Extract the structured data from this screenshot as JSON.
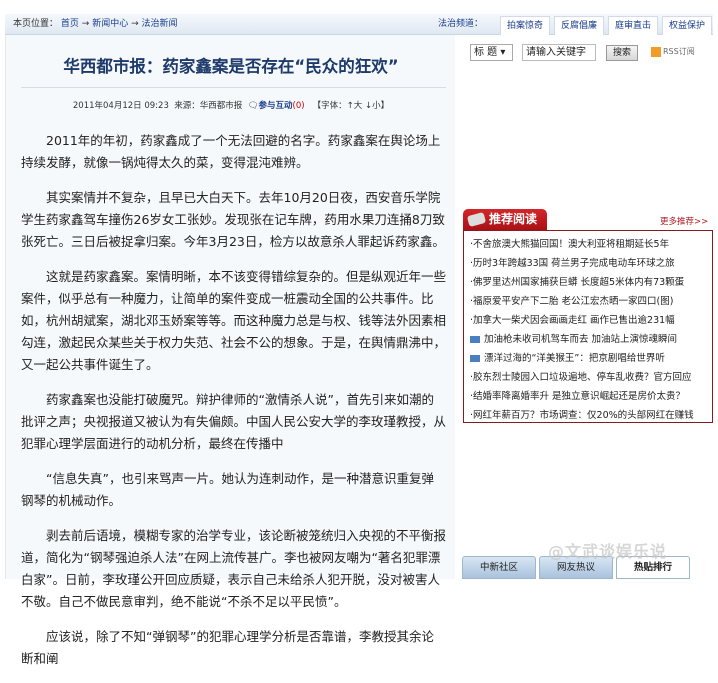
{
  "topbar": {
    "breadcrumb_label": "本页位置：",
    "crumbs": [
      "首页",
      "新闻中心",
      "法治新闻"
    ],
    "arrow": "→",
    "channel_label": "法治频道：",
    "channel_tabs": [
      "拍案惊奇",
      "反腐倡廉",
      "庭审直击",
      "权益保护"
    ]
  },
  "article": {
    "title": "华西都市报：药家鑫案是否存在“民众的狂欢”",
    "date": "2011年04月12日 09:23",
    "source": "来源：华西都市报",
    "interact": "参与互动",
    "interact_count": "(0)",
    "font_ctrl": "【字体：↑大 ↓小】",
    "paragraphs": [
      "2011年的年初，药家鑫成了一个无法回避的名字。药家鑫案在舆论场上持续发酵，就像一锅炖得太久的菜，变得混沌难辨。",
      "其实案情并不复杂，且早已大白天下。去年10月20日夜，西安音乐学院学生药家鑫驾车撞伤26岁女工张妙。发现张在记车牌，药用水果刀连捅8刀致张死亡。三日后被捉拿归案。今年3月23日，检方以故意杀人罪起诉药家鑫。",
      "这就是药家鑫案。案情明晰，本不该变得错综复杂的。但是纵观近年一些案件，似乎总有一种魔力，让简单的案件变成一桩震动全国的公共事件。比如，杭州胡斌案，湖北邓玉娇案等等。而这种魔力总是与权、钱等法外因素相勾连，激起民众某些关于权力失范、社会不公的想象。于是，在舆情鼎沸中，又一起公共事件诞生了。",
      "药家鑫案也没能打破魔咒。辩护律师的“激情杀人说”，首先引来如潮的批评之声；央视报道又被认为有失偏颇。中国人民公安大学的李玫瑾教授，从犯罪心理学层面进行的动机分析，最终在传播中",
      "“信息失真”，也引来骂声一片。她认为连刺动作，是一种潜意识重复弹钢琴的机械动作。",
      "剥去前后语境，模糊专家的治学专业，该论断被笼统归入央视的不平衡报道，简化为“钢琴强迫杀人法”在网上流传甚广。李也被网友嘲为“著名犯罪漂白家”。日前，李玫瑾公开回应质疑，表示自己未给杀人犯开脱，没对被害人不敬。自己不做民意审判，绝不能说“不杀不足以平民愤”。",
      "应该说，除了不知“弹钢琴”的犯罪心理学分析是否靠谱，李教授其余论断和阐"
    ]
  },
  "search": {
    "field_select": "标 题",
    "keyword_placeholder": "请输入关键字",
    "button": "搜索",
    "rss": "RSS订阅"
  },
  "recommend": {
    "title": "推荐阅读",
    "more": "更多推荐>>",
    "items": [
      {
        "text": "·不舍旅澳大熊猫回国！澳大利亚将租期延长5年",
        "video": false
      },
      {
        "text": "·历时3年跨越33国 荷兰男子完成电动车环球之旅",
        "video": false
      },
      {
        "text": "·佛罗里达州国家捕获巨蟒 长度超5米体内有73颗蛋",
        "video": false
      },
      {
        "text": "·福原爱平安产下二胎 老公江宏杰晒一家四口(图)",
        "video": false
      },
      {
        "text": "·加拿大一柴犬因会画画走红 画作已售出逾231幅",
        "video": false
      },
      {
        "text": "加油枪未收司机驾车而去 加油站上演惊魂瞬间",
        "video": true
      },
      {
        "text": "漂洋过海的“洋美猴王”：把京剧唱给世界听",
        "video": true
      },
      {
        "text": "·胶东烈士陵园入口垃圾遍地、停车乱收费？官方回应",
        "video": false
      },
      {
        "text": "·结婚率降离婚率升 是独立意识崛起还是房价太贵？",
        "video": false
      },
      {
        "text": "·网红年薪百万？市场调查：仅20%的头部网红在赚钱",
        "video": false
      }
    ]
  },
  "bottom_tabs": [
    "中新社区",
    "网友热议",
    "热贴排行"
  ],
  "watermark": "@文武谈娱乐说",
  "colors": {
    "accent_red": "#b01c20",
    "link_blue": "#1a3c8c"
  }
}
